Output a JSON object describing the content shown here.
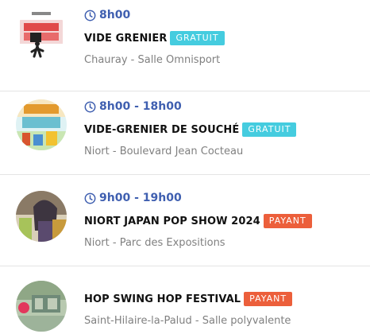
{
  "colors": {
    "time_accent": "#3f5fb0",
    "badge_free": "#45ccdf",
    "badge_paid": "#ec5f3b",
    "title": "#111111",
    "location": "#808080",
    "divider": "#e4e4e4"
  },
  "events": [
    {
      "time": "8h00",
      "title": "VIDE GRENIER",
      "badge": "GRATUIT",
      "badge_type": "free",
      "location": "Chauray - Salle Omnisport",
      "thumbnail": "vide-grenier-poster-image"
    },
    {
      "time": "8h00 - 18h00",
      "title": "VIDE-GRENIER DE SOUCHÉ",
      "badge": "GRATUIT",
      "badge_type": "free",
      "location": "Niort - Boulevard Jean Cocteau",
      "thumbnail": "vide-grenier-souche-poster-image"
    },
    {
      "time": "9h00 - 19h00",
      "title": "NIORT JAPAN POP SHOW 2024",
      "badge": "PAYANT",
      "badge_type": "paid",
      "location": "Niort - Parc des Expositions",
      "thumbnail": "japan-pop-show-poster-image"
    },
    {
      "time": "",
      "title": "HOP SWING HOP FESTIVAL",
      "badge": "PAYANT",
      "badge_type": "paid",
      "location": "Saint-Hilaire-la-Palud - Salle polyvalente",
      "thumbnail": "hop-swing-hop-poster-image"
    }
  ]
}
